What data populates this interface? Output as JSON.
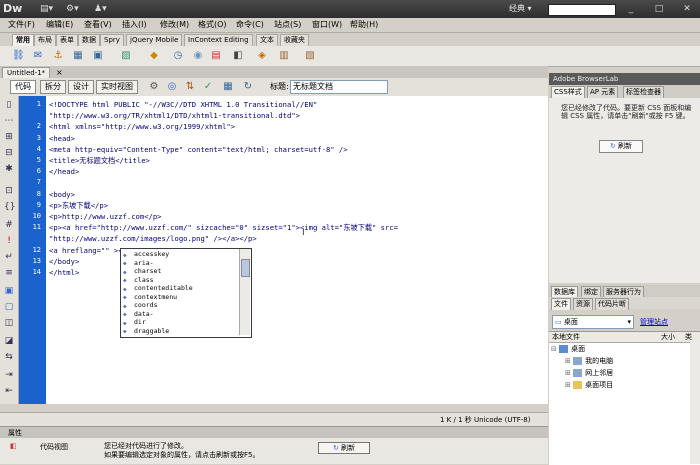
{
  "app": {
    "logo": "Dw",
    "workspace": "经典"
  },
  "menu": [
    "文件(F)",
    "编辑(E)",
    "查看(V)",
    "插入(I)",
    "修改(M)",
    "格式(O)",
    "命令(C)",
    "站点(S)",
    "窗口(W)",
    "帮助(H)"
  ],
  "insert_tabs": [
    "常用",
    "布局",
    "表单",
    "数据",
    "Spry",
    "jQuery Mobile",
    "InContext Editing",
    "文本",
    "收藏夹"
  ],
  "document": {
    "tab": "Untitled-1*",
    "views": [
      "代码",
      "拆分",
      "设计",
      "实时视图"
    ],
    "title_label": "标题:",
    "title_value": "无标题文档"
  },
  "code_lines": [
    {
      "n": "1",
      "text": "<!DOCTYPE html PUBLIC \"-//W3C//DTD XHTML 1.0 Transitional//EN\""
    },
    {
      "n": "",
      "text": "\"http://www.w3.org/TR/xhtml1/DTD/xhtml1-transitional.dtd\">"
    },
    {
      "n": "2",
      "text": "<html xmlns=\"http://www.w3.org/1999/xhtml\">"
    },
    {
      "n": "3",
      "text": "<head>"
    },
    {
      "n": "4",
      "text": "<meta http-equiv=\"Content-Type\" content=\"text/html; charset=utf-8\" />"
    },
    {
      "n": "5",
      "text": "<title>无标题文档</title>"
    },
    {
      "n": "6",
      "text": "</head>"
    },
    {
      "n": "7",
      "text": ""
    },
    {
      "n": "8",
      "text": "<body>"
    },
    {
      "n": "9",
      "text": "<p>东坡下载</p>"
    },
    {
      "n": "10",
      "text": "<p>http://www.uzzf.com</p>"
    },
    {
      "n": "11",
      "text": "<p><a href=\"http://www.uzzf.com/\" sizcache=\"0\" sizset=\"1\"><img alt=\"东坡下载\" src="
    },
    {
      "n": "",
      "text": "\"http://www.uzzf.com/images/logo.png\" /></a></p>"
    },
    {
      "n": "12",
      "text": "<a hreflang=\"\" ></a>"
    },
    {
      "n": "13",
      "text": "</body>"
    },
    {
      "n": "14",
      "text": "</html>"
    }
  ],
  "hints": [
    "accesskey",
    "aria-",
    "charset",
    "class",
    "contenteditable",
    "contextmenu",
    "coords",
    "data-",
    "dir",
    "draggable"
  ],
  "status": {
    "info": "1 K / 1 秒  Unicode (UTF-8)"
  },
  "properties": {
    "header": "属性",
    "code_view_label": "代码视图",
    "message_line1": "您已经对代码进行了修改。",
    "message_line2": "如果要编辑选定对象的属性，请点击刷新或按F5。",
    "refresh": "刷新"
  },
  "right_panel": {
    "browserlab": "Adobe BrowserLab",
    "tabs": [
      "CSS样式",
      "AP 元素",
      "标签检查器"
    ],
    "message": "您已经修改了代码。要更新 CSS 面板和编辑 CSS 属性，请单击\"刷新\"或按 F5 键。",
    "refresh": "刷新",
    "files_tabs_1": [
      "数据库",
      "绑定",
      "服务器行为"
    ],
    "files_tabs_2": [
      "文件",
      "资源",
      "代码片断"
    ],
    "site_select": "桌面",
    "manage": "管理站点",
    "columns": [
      "本地文件",
      "大小",
      "类"
    ],
    "tree": [
      {
        "label": "桌面",
        "level": 0
      },
      {
        "label": "我的电脑",
        "level": 1
      },
      {
        "label": "网上邻居",
        "level": 1
      },
      {
        "label": "桌面项目",
        "level": 1
      }
    ]
  }
}
